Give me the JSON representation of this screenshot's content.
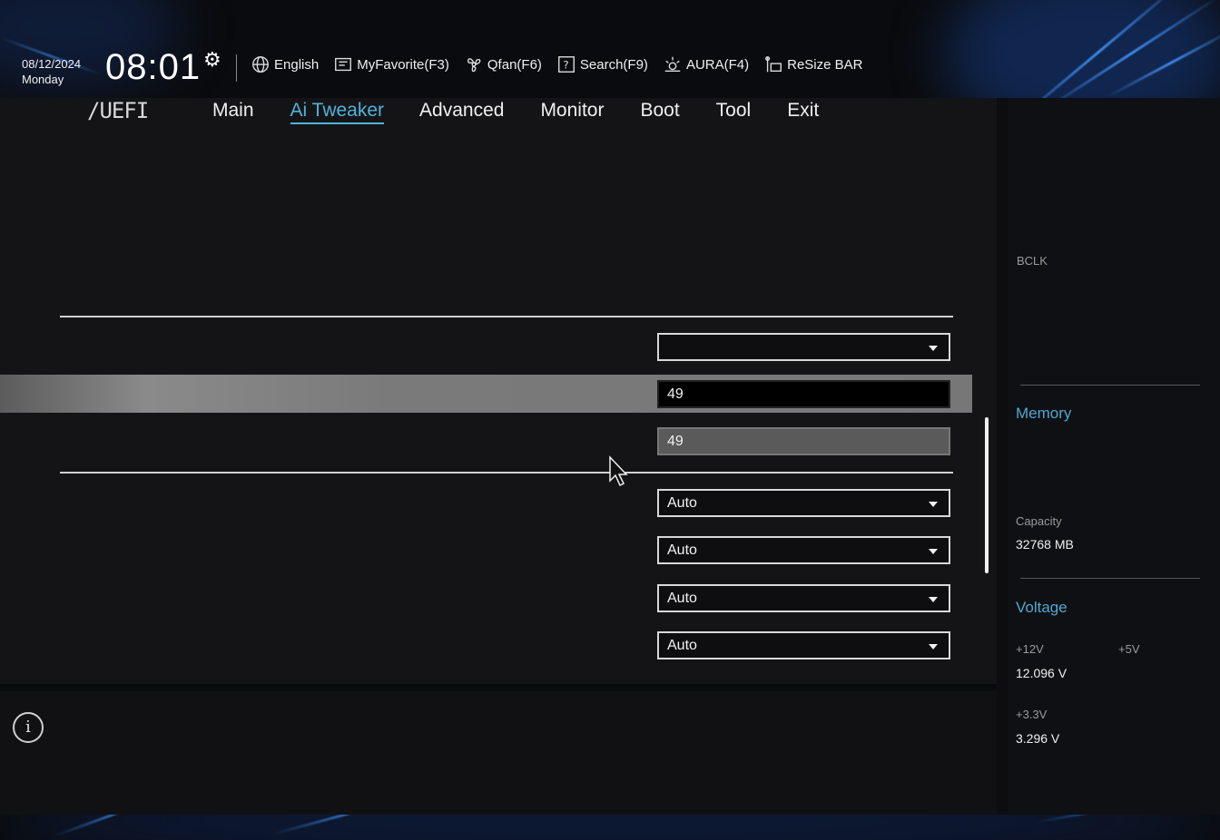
{
  "header": {
    "date": "08/12/2024",
    "weekday": "Monday",
    "time": "08:01",
    "tools": [
      {
        "label": "English",
        "icon": "globe-icon"
      },
      {
        "label": "MyFavorite(F3)",
        "icon": "favorite-icon"
      },
      {
        "label": "Qfan(F6)",
        "icon": "fan-icon"
      },
      {
        "label": "Search(F9)",
        "icon": "search-icon"
      },
      {
        "label": "AURA(F4)",
        "icon": "aura-icon"
      },
      {
        "label": "ReSize BAR",
        "icon": "resize-bar-icon"
      }
    ]
  },
  "nav": {
    "logo": "/UEFI",
    "tabs": [
      "Main",
      "Ai Tweaker",
      "Advanced",
      "Monitor",
      "Boot",
      "Tool",
      "Exit"
    ],
    "active_tab": "Ai Tweaker"
  },
  "settings": {
    "rows": [
      {
        "value": "",
        "kind": "dropdown"
      },
      {
        "value": "49",
        "kind": "input",
        "state": "selected"
      },
      {
        "value": "49",
        "kind": "input",
        "state": "disabled"
      },
      {
        "value": "Auto",
        "kind": "dropdown"
      },
      {
        "value": "Auto",
        "kind": "dropdown"
      },
      {
        "value": "Auto",
        "kind": "dropdown"
      },
      {
        "value": "Auto",
        "kind": "dropdown"
      }
    ]
  },
  "hw_monitor": {
    "bclk_label": "BCLK",
    "memory_title": "Memory",
    "capacity_label": "Capacity",
    "capacity_value": "32768 MB",
    "voltage_title": "Voltage",
    "v12_label": "+12V",
    "v12_value": "12.096 V",
    "v5_label": "+5V",
    "v33_label": "+3.3V",
    "v33_value": "3.296 V"
  },
  "colors": {
    "accent": "#4fb3d9",
    "panel": "#141416",
    "highlight": "#7a7a7a"
  }
}
